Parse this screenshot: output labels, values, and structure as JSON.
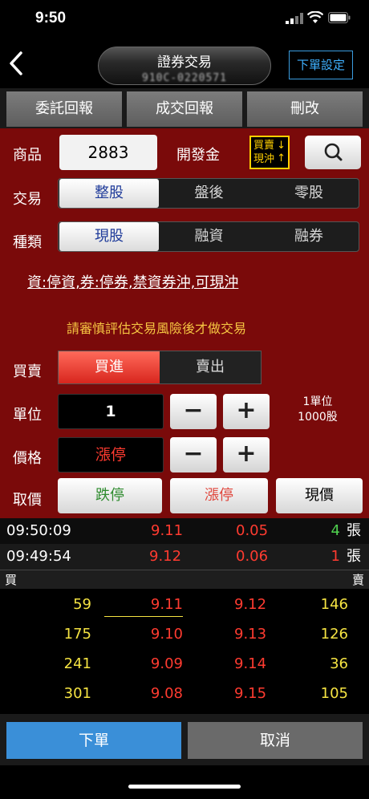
{
  "status": {
    "time": "9:50"
  },
  "nav": {
    "title": "證券交易",
    "account": "910C-0220571",
    "order_settings": "下單設定"
  },
  "tabs": [
    "委託回報",
    "成交回報",
    "刪改"
  ],
  "form": {
    "product_label": "商品",
    "product_code": "2883",
    "product_name": "開發金",
    "swap_badge": {
      "line1": "買賣",
      "line2": "現沖"
    },
    "trade_label": "交易",
    "trade_options": [
      "整股",
      "盤後",
      "零股"
    ],
    "type_label": "種類",
    "type_options": [
      "現股",
      "融資",
      "融券"
    ],
    "notice": "資:停資,券:停券,禁資券沖,可現沖",
    "warning": "請審慎評估交易風險後才做交易",
    "side_label": "買賣",
    "side_buy": "買進",
    "side_sell": "賣出",
    "unit_label": "單位",
    "unit_value": "1",
    "unit_note_line1": "1單位",
    "unit_note_line2": "1000股",
    "price_label": "價格",
    "price_value": "漲停",
    "pick_label": "取價",
    "pick_limit_down": "跌停",
    "pick_limit_up": "漲停",
    "pick_current": "現價",
    "minus": "−",
    "plus": "+"
  },
  "ticks": [
    {
      "time": "09:50:09",
      "price": "9.11",
      "change": "0.05",
      "qty": "4",
      "unit": "張",
      "qty_color": "#4fd24f"
    },
    {
      "time": "09:49:54",
      "price": "9.12",
      "change": "0.06",
      "qty": "1",
      "unit": "張",
      "qty_color": "#ff3b30"
    }
  ],
  "book_header": {
    "buy": "買",
    "sell": "賣"
  },
  "book": [
    {
      "bid_qty": "59",
      "bid": "9.11",
      "ask": "9.12",
      "ask_qty": "146"
    },
    {
      "bid_qty": "175",
      "bid": "9.10",
      "ask": "9.13",
      "ask_qty": "126"
    },
    {
      "bid_qty": "241",
      "bid": "9.09",
      "ask": "9.14",
      "ask_qty": "36"
    },
    {
      "bid_qty": "301",
      "bid": "9.08",
      "ask": "9.15",
      "ask_qty": "105"
    }
  ],
  "actions": {
    "submit": "下單",
    "cancel": "取消"
  },
  "colors": {
    "panel": "#7a0a0a",
    "accent_blue": "#3a8fd8",
    "price_red": "#ff3b30",
    "qty_yellow": "#f5e342",
    "seg_selected_text": "#1f3b9a"
  }
}
